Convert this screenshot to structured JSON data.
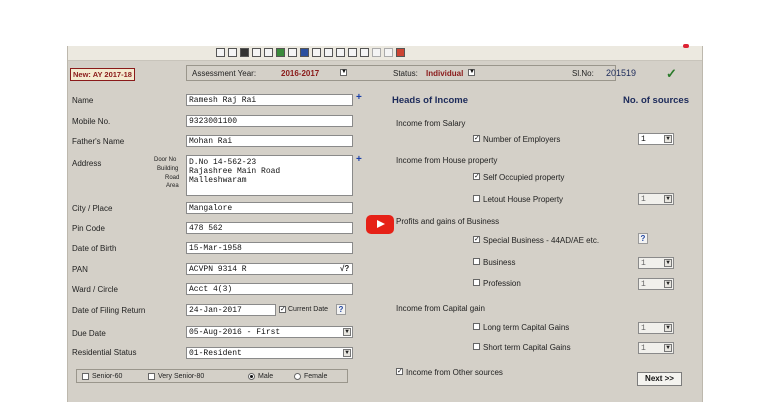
{
  "header": {
    "new_ay": "New: AY 2017-18",
    "assessment_year_label": "Assessment Year:",
    "assessment_year_value": "2016-2017",
    "status_label": "Status:",
    "status_value": "Individual",
    "slno_label": "Sl.No:",
    "slno_value": "201519",
    "check_mark": "✓"
  },
  "form": {
    "name_label": "Name",
    "name_value": "Ramesh Raj Rai",
    "mobile_label": "Mobile No.",
    "mobile_value": "9323001100",
    "father_label": "Father's Name",
    "father_value": "Mohan Rai",
    "address_label": "Address",
    "address_sub": [
      "Door No",
      "Building",
      "Road",
      "Area"
    ],
    "address_lines": [
      "D.No 14-562-23",
      "Rajashree Main Road",
      "Malleshwaram"
    ],
    "city_label": "City / Place",
    "city_value": "Mangalore",
    "pin_label": "Pin Code",
    "pin_value": "478 562",
    "dob_label": "Date of Birth",
    "dob_value": "15-Mar-1958",
    "pan_label": "PAN",
    "pan_value": "ACVPN 9314 R",
    "pan_hint": "√?",
    "ward_label": "Ward / Circle",
    "ward_value": "Acct 4(3)",
    "filing_label": "Date of Filing Return",
    "filing_value": "24-Jan-2017",
    "current_date_label": "Current Date",
    "due_label": "Due Date",
    "due_value": "05-Aug-2016 - First",
    "res_label": "Residential Status",
    "res_value": "01-Resident",
    "senior60": "Senior-60",
    "very_senior80": "Very Senior-80",
    "male": "Male",
    "female": "Female"
  },
  "income": {
    "heads_title": "Heads of Income",
    "sources_title": "No. of sources",
    "salary_section": "Income from Salary",
    "employers_label": "Number of Employers",
    "employers_value": "1",
    "house_section": "Income from House property",
    "self_occupied": "Self Occupied property",
    "letout": "Letout House Property",
    "letout_value": "1",
    "business_section": "Profits and gains of Business",
    "special_business": "Special Business - 44AD/AE etc.",
    "business": "Business",
    "business_value": "1",
    "profession": "Profession",
    "profession_value": "1",
    "capital_section": "Income from Capital gain",
    "ltcg": "Long term Capital Gains",
    "ltcg_value": "1",
    "stcg": "Short term Capital Gains",
    "stcg_value": "1",
    "other_sources": "Income from Other sources",
    "next_button": "Next >>"
  },
  "icons": {
    "dropdown": "▼",
    "help": "?",
    "plus": "+",
    "check": "✓"
  }
}
